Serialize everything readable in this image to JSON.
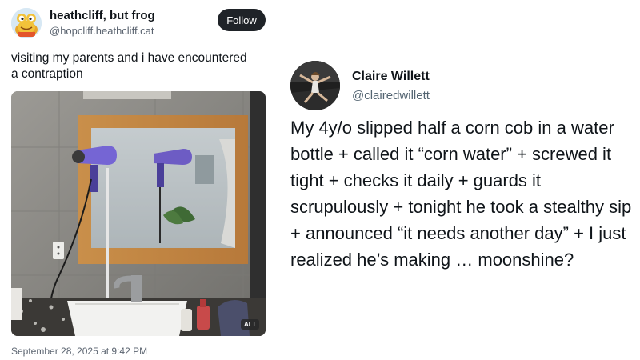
{
  "left_post": {
    "author": {
      "display_name": "heathcliff, but frog",
      "handle": "@hopcliff.heathcliff.cat"
    },
    "follow_label": "Follow",
    "text": "visiting my parents and i have encountered a contraption",
    "alt_badge": "ALT",
    "timestamp": "September 28, 2025 at 9:42 PM",
    "icons": [
      "frog-avatar-icon"
    ]
  },
  "right_post": {
    "author": {
      "display_name": "Claire Willett",
      "handle": "@clairedwillett"
    },
    "text": "My 4y/o slipped half a corn cob in a water bottle + called it “corn water” + screwed it tight + checks it daily + guards it scrupulously + tonight he took a stealthy sip + announced “it needs another day” + I just realized he’s making … moonshine?"
  },
  "colors": {
    "follow_button": "#1f2328",
    "text": "#0f1419",
    "secondary_text": "#5b6470"
  }
}
